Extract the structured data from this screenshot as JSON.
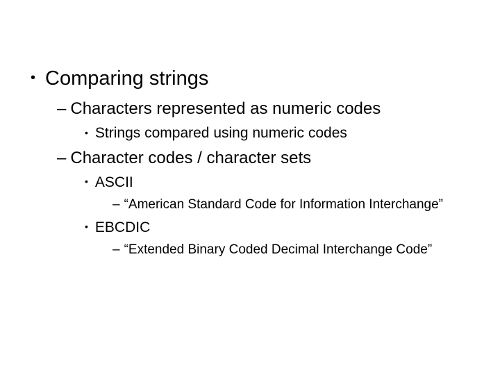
{
  "slide": {
    "heading": "Comparing strings",
    "sub1": {
      "text": "Characters represented as numeric codes",
      "children": [
        {
          "text": "Strings compared using numeric codes"
        }
      ]
    },
    "sub2": {
      "text": "Character codes / character sets",
      "children": [
        {
          "text": "ASCII",
          "children": [
            {
              "text": "“American Standard Code for Information Interchange”"
            }
          ]
        },
        {
          "text": "EBCDIC",
          "children": [
            {
              "text": "“Extended Binary Coded Decimal Interchange Code”"
            }
          ]
        }
      ]
    }
  }
}
